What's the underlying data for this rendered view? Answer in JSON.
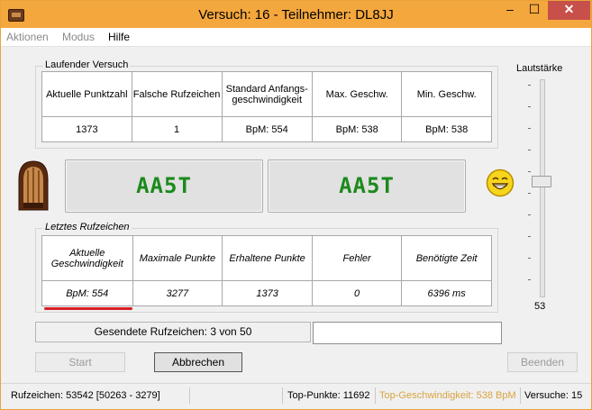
{
  "window": {
    "title": "Versuch: 16 - Teilnehmer: DL8JJ",
    "minimize_glyph": "–",
    "maximize_glyph": "☐",
    "close_glyph": "✕"
  },
  "menu": {
    "items": [
      "Aktionen",
      "Modus",
      "Hilfe"
    ]
  },
  "running_attempt": {
    "label": "Laufender Versuch",
    "headers": [
      "Aktuelle Punktzahl",
      "Falsche Rufzeichen",
      "Standard Anfangs-geschwindigkeit",
      "Max. Geschw.",
      "Min. Geschw."
    ],
    "values": [
      "1373",
      "1",
      "BpM: 554",
      "BpM: 538",
      "BpM: 538"
    ]
  },
  "callsigns": {
    "sent": "AA5T",
    "received": "AA5T"
  },
  "last_callsign": {
    "label": "Letztes Rufzeichen",
    "headers": [
      "Aktuelle Geschwindigkeit",
      "Maximale Punkte",
      "Erhaltene Punkte",
      "Fehler",
      "Benötigte Zeit"
    ],
    "values": [
      "BpM: 554",
      "3277",
      "1373",
      "0",
      "6396 ms"
    ]
  },
  "volume": {
    "label": "Lautstärke",
    "value": "53",
    "level_fraction": 0.53
  },
  "sent_status": "Gesendete Rufzeichen: 3 von 50",
  "input": {
    "value": ""
  },
  "buttons": {
    "start": "Start",
    "cancel": "Abbrechen",
    "finish": "Beenden"
  },
  "statusbar": {
    "callsigns": "Rufzeichen: 53542 [50263 - 3279]",
    "top_points": "Top-Punkte: 11692",
    "top_speed": "Top-Geschwindigkeit: 538 BpM",
    "attempts": "Versuche: 15"
  },
  "colors": {
    "titlebar": "#f4a73d",
    "callsign_text": "#1b8a1b",
    "top_speed_text": "#d9a441",
    "highlight_line": "#d81f26"
  },
  "icons": {
    "radio": "vintage-radio-icon",
    "smiley": "laughing-smiley-icon"
  }
}
